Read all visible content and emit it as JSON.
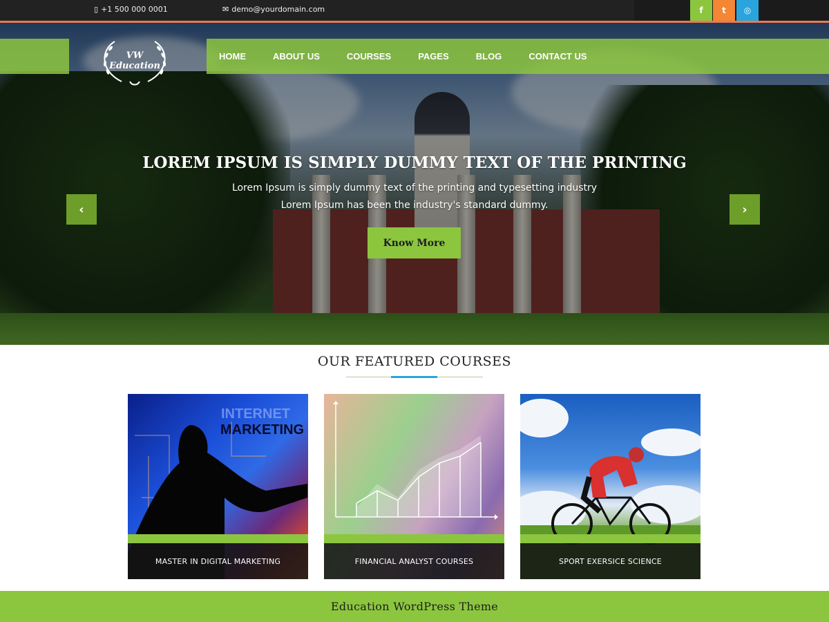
{
  "topbar": {
    "phone": "+1 500 000 0001",
    "email": "demo@yourdomain.com",
    "social": [
      {
        "name": "facebook-icon",
        "glyph": "f",
        "color": "#8cc63f"
      },
      {
        "name": "twitter-icon",
        "glyph": "t",
        "color": "#f58634"
      },
      {
        "name": "instagram-icon",
        "glyph": "◎",
        "color": "#29a4dd"
      }
    ]
  },
  "logo": {
    "line1": "VW",
    "line2": "Education"
  },
  "nav": {
    "items": [
      "HOME",
      "ABOUT US",
      "COURSES",
      "PAGES",
      "BLOG",
      "CONTACT US"
    ]
  },
  "slider": {
    "title": "LOREM IPSUM IS SIMPLY DUMMY TEXT OF THE PRINTING",
    "text": "Lorem Ipsum is simply dummy text of the printing and typesetting industry Lorem Ipsum has been the industry's standard dummy.",
    "button": "Know More",
    "prev_glyph": "‹",
    "next_glyph": "›"
  },
  "featured": {
    "title": "OUR FEATURED COURSES",
    "courses": [
      {
        "label": "MASTER IN DIGITAL MARKETING",
        "image_text": "INTERNET MARKETING"
      },
      {
        "label": "FINANCIAL ANALYST COURSES"
      },
      {
        "label": "SPORT EXERSICE SCIENCE"
      }
    ]
  },
  "footer": {
    "text": "Education WordPress Theme"
  },
  "colors": {
    "accent": "#8cc63f",
    "orange": "#f58634",
    "blue": "#29a4dd",
    "dark": "#1b1b1b"
  }
}
